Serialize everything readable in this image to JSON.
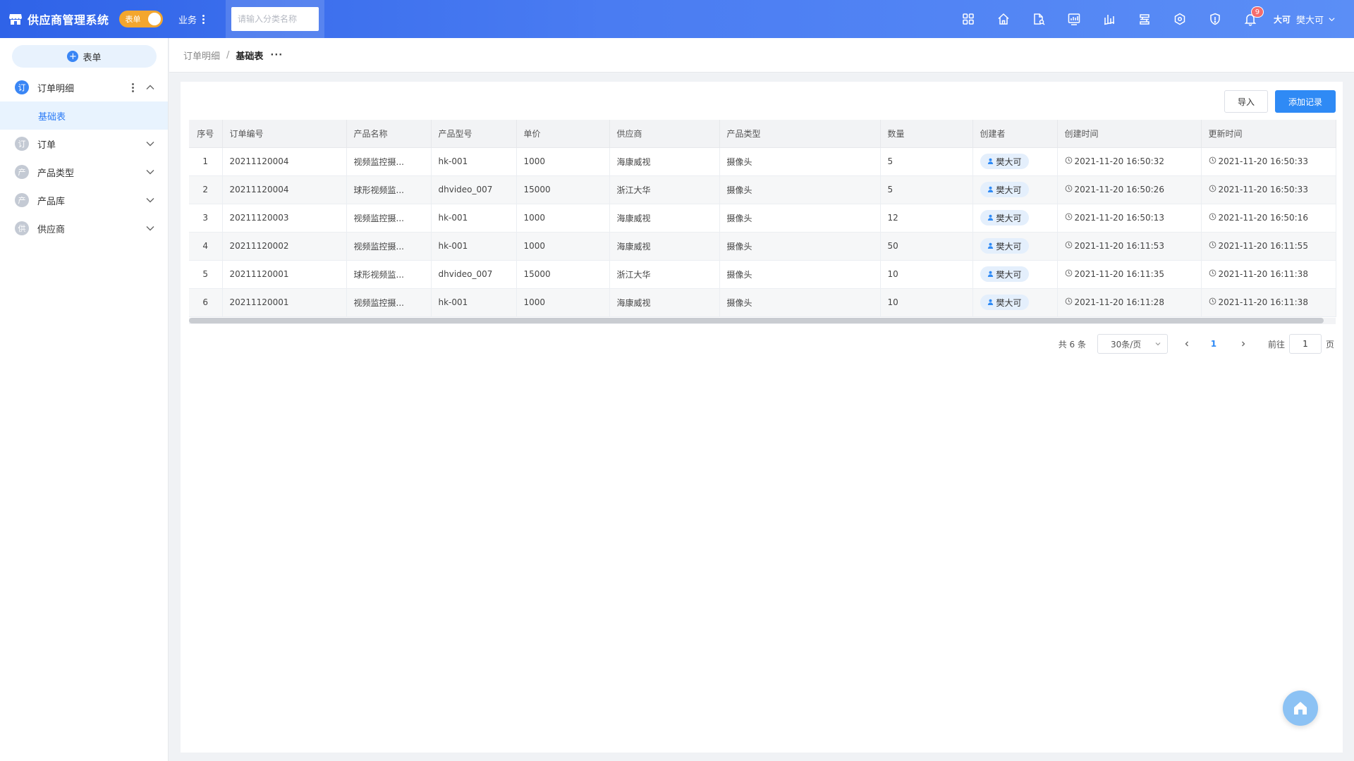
{
  "header": {
    "title": "供应商管理系统",
    "toggle_label": "表单",
    "nav_label": "业务",
    "search_placeholder": "请输入分类名称",
    "icons": [
      "apps-icon",
      "home-icon",
      "file-search-icon",
      "dashboard-icon",
      "chart-icon",
      "layers-icon",
      "network-icon",
      "shield-icon",
      "bell-icon"
    ],
    "notification_count": "9",
    "user_avatar_text": "大可",
    "user_name": "樊大可"
  },
  "sidebar": {
    "add_label": "表单",
    "items": [
      {
        "icon_char": "订",
        "label": "订单明细",
        "open": true
      },
      {
        "icon_char": "订",
        "label": "订单",
        "open": false
      },
      {
        "icon_char": "产",
        "label": "产品类型",
        "open": false
      },
      {
        "icon_char": "产",
        "label": "产品库",
        "open": false
      },
      {
        "icon_char": "供",
        "label": "供应商",
        "open": false
      }
    ],
    "sub_item": "基础表"
  },
  "breadcrumb": {
    "parent": "订单明细",
    "separator": "/",
    "current": "基础表",
    "more": "···"
  },
  "toolbar": {
    "import_label": "导入",
    "add_label": "添加记录"
  },
  "table": {
    "columns": [
      "序号",
      "订单编号",
      "产品名称",
      "产品型号",
      "单价",
      "供应商",
      "产品类型",
      "数量",
      "创建者",
      "创建时间",
      "更新时间"
    ],
    "rows": [
      [
        "1",
        "20211120004",
        "视频监控摄...",
        "hk-001",
        "1000",
        "海康威视",
        "摄像头",
        "5",
        "樊大可",
        "2021-11-20 16:50:32",
        "2021-11-20 16:50:33"
      ],
      [
        "2",
        "20211120004",
        "球形视频监...",
        "dhvideo_007",
        "15000",
        "浙江大华",
        "摄像头",
        "5",
        "樊大可",
        "2021-11-20 16:50:26",
        "2021-11-20 16:50:33"
      ],
      [
        "3",
        "20211120003",
        "视频监控摄...",
        "hk-001",
        "1000",
        "海康威视",
        "摄像头",
        "12",
        "樊大可",
        "2021-11-20 16:50:13",
        "2021-11-20 16:50:16"
      ],
      [
        "4",
        "20211120002",
        "视频监控摄...",
        "hk-001",
        "1000",
        "海康威视",
        "摄像头",
        "50",
        "樊大可",
        "2021-11-20 16:11:53",
        "2021-11-20 16:11:55"
      ],
      [
        "5",
        "20211120001",
        "球形视频监...",
        "dhvideo_007",
        "15000",
        "浙江大华",
        "摄像头",
        "10",
        "樊大可",
        "2021-11-20 16:11:35",
        "2021-11-20 16:11:38"
      ],
      [
        "6",
        "20211120001",
        "视频监控摄...",
        "hk-001",
        "1000",
        "海康威视",
        "摄像头",
        "10",
        "樊大可",
        "2021-11-20 16:11:28",
        "2021-11-20 16:11:38"
      ]
    ]
  },
  "pagination": {
    "total": "共 6 条",
    "page_size": "30条/页",
    "current_page": "1",
    "goto_label": "前往",
    "goto_value": "1",
    "page_unit": "页"
  },
  "colors": {
    "header_start": "#2f63e8",
    "header_end": "#5b8ef6",
    "accent": "#2f8af5",
    "toggle": "#f3a62e",
    "badge": "#f56c6c"
  }
}
